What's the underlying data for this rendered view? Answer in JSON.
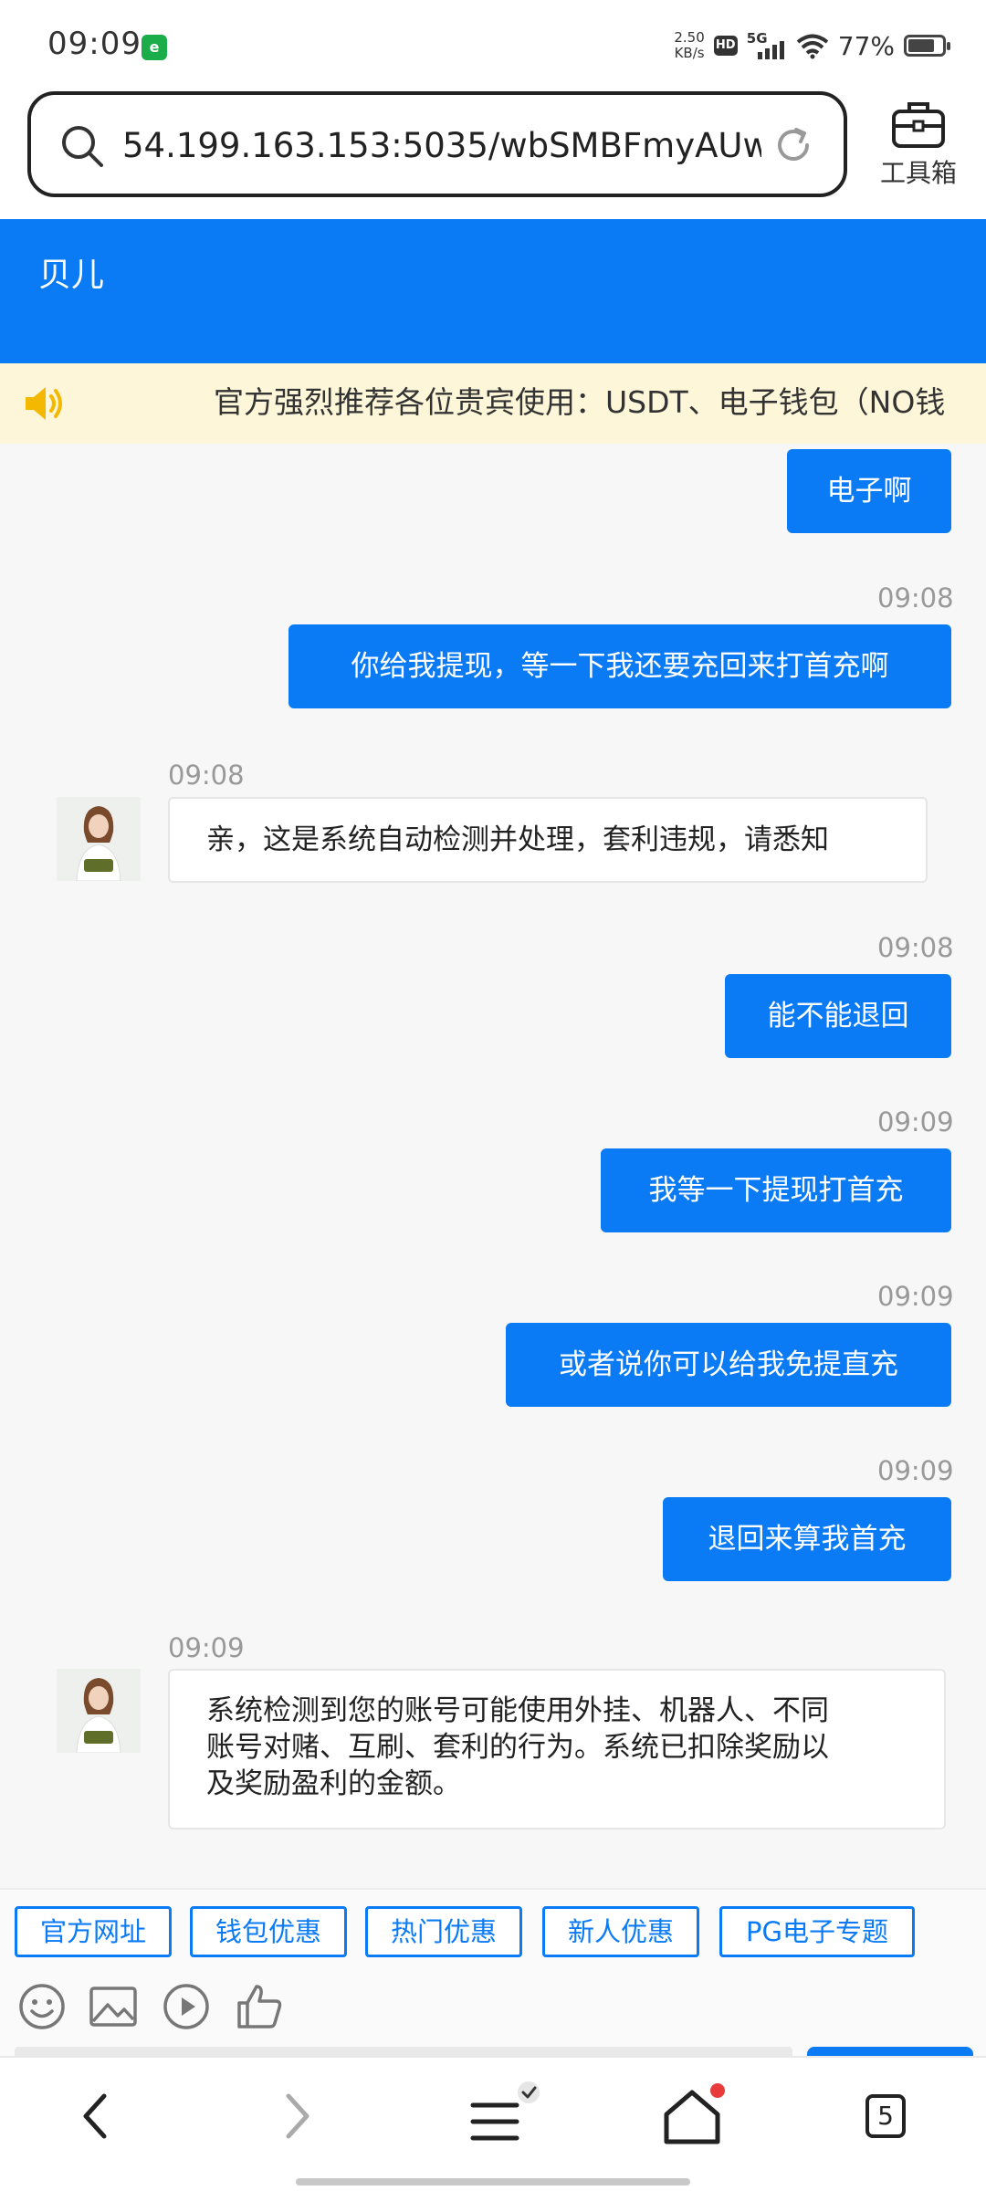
{
  "status_bar": {
    "time": "09:09",
    "net_speed_value": "2.50",
    "net_speed_unit": "KB/s",
    "hd_label": "HD",
    "network": "5G",
    "battery": "77%"
  },
  "browser": {
    "url": "54.199.163.153:5035/wbSMBFmyAUw...",
    "toolbox_label": "工具箱"
  },
  "chat": {
    "agent_name": "贝儿",
    "notice": "官方强烈推荐各位贵宾使用：USDT、电子钱包（NO钱",
    "messages": [
      {
        "side": "out",
        "time": "",
        "text": "电子啊"
      },
      {
        "side": "out",
        "time": "09:08",
        "text": "你给我提现，等一下我还要充回来打首充啊"
      },
      {
        "side": "in",
        "time": "09:08",
        "lines": [
          "亲，这是系统自动检测并处理，套利违规，请悉知"
        ]
      },
      {
        "side": "out",
        "time": "09:08",
        "text": "能不能退回"
      },
      {
        "side": "out",
        "time": "09:09",
        "text": "我等一下提现打首充"
      },
      {
        "side": "out",
        "time": "09:09",
        "text": "或者说你可以给我免提直充"
      },
      {
        "side": "out",
        "time": "09:09",
        "text": "退回来算我首充"
      },
      {
        "side": "in",
        "time": "09:09",
        "lines": [
          "系统检测到您的账号可能使用外挂、机器人、不同",
          "账号对赌、互刷、套利的行为。系统已扣除奖励以",
          "及奖励盈利的金额。"
        ]
      }
    ]
  },
  "quick_replies": [
    "官方网址",
    "钱包优惠",
    "热门优惠",
    "新人优惠",
    "PG电子专题"
  ],
  "nav": {
    "tabs_count": "5"
  },
  "colors": {
    "accent": "#0a7bf5",
    "notice_bg": "#fdf6d8",
    "notice_icon": "#f5b800",
    "chat_bg": "#f7f7f7"
  }
}
